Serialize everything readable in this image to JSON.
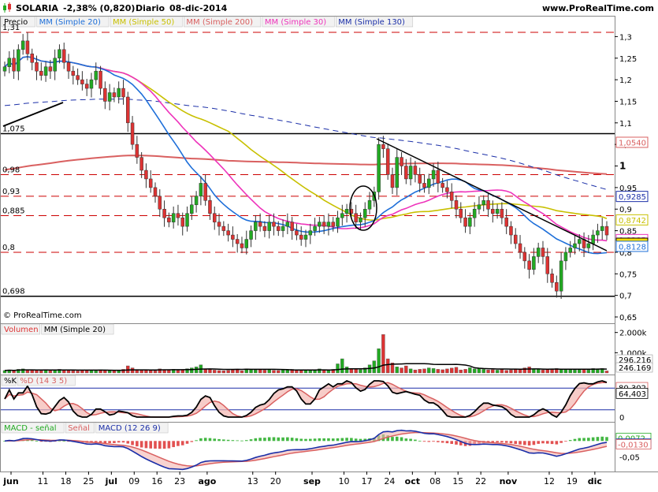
{
  "header": {
    "ticker": "SOLARIA",
    "change": "-2,38% (0,820)",
    "period": "Diario",
    "date": "08-dic-2014",
    "site": "www.ProRealTime.com",
    "copyright": "© ProRealTime.com"
  },
  "colors": {
    "price_up": "#22aa22",
    "price_down": "#dd3333",
    "sma20": "#1e6fd9",
    "sma50": "#c8c000",
    "sma200": "#d96060",
    "sma30": "#ee33bb",
    "sma130": "#1b2fa8",
    "grid_dash": "#cc0000",
    "macd_line": "#1b2fa8",
    "signal_line": "#d96060",
    "stoch_k": "#000000",
    "stoch_d": "#d96060"
  },
  "price_panel": {
    "legend": [
      "Precio",
      "MM (Simple 20)",
      "MM (Simple 50)",
      "MM (Simple 200)",
      "MM (Simple 30)",
      "MM (Simple 130)"
    ],
    "left_labels": [
      {
        "text": "1,31",
        "value": 1.31
      },
      {
        "text": "1,075",
        "value": 1.075
      },
      {
        "text": "0,98",
        "value": 0.98
      },
      {
        "text": "0,93",
        "value": 0.93
      },
      {
        "text": "0,885",
        "value": 0.885
      },
      {
        "text": "0,8",
        "value": 0.8
      },
      {
        "text": "0,698",
        "value": 0.698
      }
    ],
    "axis_ticks": [
      "1,3",
      "1,25",
      "1,2",
      "1,15",
      "1,1",
      "1,05",
      "1",
      "0,95",
      "0,9",
      "0,85",
      "0,8",
      "0,75",
      "0,7",
      "0,65"
    ],
    "right_tags": [
      {
        "text": "1,0540",
        "value": 1.054,
        "color": "#d96060"
      },
      {
        "text": "0,9285",
        "value": 0.9285,
        "color": "#1b2fa8"
      },
      {
        "text": "0,8742",
        "value": 0.8742,
        "color": "#c8c000"
      },
      {
        "text": "0,8285",
        "value": 0.8285,
        "color": "#ee33bb"
      },
      {
        "text": "0,820",
        "value": 0.82,
        "color": "#000000"
      },
      {
        "text": "0,8128",
        "value": 0.8128,
        "color": "#1e6fd9"
      }
    ]
  },
  "volume_panel": {
    "legend": [
      "Volumen",
      "MM (Simple 20)"
    ],
    "axis_ticks": [
      "2.000k",
      "1.000k"
    ],
    "right_tags": [
      {
        "text": "296.216",
        "value": 296216
      },
      {
        "text": "246.169",
        "value": 246169
      }
    ]
  },
  "stoch_panel": {
    "legend": [
      "%K",
      "%D (14 3 5)"
    ],
    "axis_ticks": [
      "0"
    ],
    "right_tags": [
      {
        "text": "80,302",
        "value": 80.302
      },
      {
        "text": "64,403",
        "value": 64.403
      }
    ]
  },
  "macd_panel": {
    "legend": [
      "MACD - señal",
      "Señal",
      "MACD (12 26 9)"
    ],
    "axis_ticks": [
      "-0,05"
    ],
    "right_tags": [
      {
        "text": "0,0072",
        "value": 0.0072
      },
      {
        "text": "-0,0057",
        "value": -0.0057
      },
      {
        "text": "-0,0130",
        "value": -0.013
      }
    ]
  },
  "x_axis": {
    "labels": [
      "jun",
      "11",
      "18",
      "25",
      "jul",
      "09",
      "16",
      "23",
      "ago",
      "13",
      "20",
      "sep",
      "10",
      "17",
      "24",
      "oct",
      "08",
      "15",
      "22",
      "nov",
      "12",
      "19",
      "dic"
    ],
    "idx": [
      0,
      7,
      12,
      17,
      22,
      27,
      32,
      37,
      43,
      53,
      58,
      66,
      73,
      78,
      83,
      88,
      93,
      98,
      103,
      109,
      118,
      123,
      128
    ]
  },
  "chart_data": {
    "type": "candlestick",
    "title": "SOLARIA -2,38% (0,820) Diario 08-dic-2014",
    "x_start": "jun 2014",
    "x_end": "08-dic-2014",
    "price_range": [
      0.65,
      1.33
    ],
    "close": [
      1.23,
      1.25,
      1.22,
      1.27,
      1.29,
      1.26,
      1.24,
      1.22,
      1.21,
      1.23,
      1.22,
      1.25,
      1.27,
      1.24,
      1.22,
      1.21,
      1.2,
      1.19,
      1.18,
      1.2,
      1.22,
      1.18,
      1.15,
      1.17,
      1.16,
      1.18,
      1.16,
      1.1,
      1.05,
      1.02,
      0.99,
      0.97,
      0.95,
      0.93,
      0.9,
      0.88,
      0.87,
      0.89,
      0.88,
      0.86,
      0.89,
      0.91,
      0.93,
      0.96,
      0.92,
      0.89,
      0.87,
      0.86,
      0.85,
      0.84,
      0.83,
      0.82,
      0.81,
      0.83,
      0.85,
      0.87,
      0.86,
      0.85,
      0.87,
      0.86,
      0.85,
      0.86,
      0.87,
      0.85,
      0.84,
      0.83,
      0.84,
      0.85,
      0.86,
      0.87,
      0.86,
      0.87,
      0.86,
      0.88,
      0.89,
      0.9,
      0.89,
      0.87,
      0.88,
      0.9,
      0.92,
      0.94,
      1.05,
      1.04,
      0.98,
      0.95,
      1.02,
      1.0,
      0.97,
      1.0,
      0.98,
      0.96,
      0.95,
      0.97,
      0.99,
      0.96,
      0.95,
      0.94,
      0.92,
      0.9,
      0.88,
      0.86,
      0.88,
      0.9,
      0.91,
      0.92,
      0.9,
      0.89,
      0.9,
      0.88,
      0.86,
      0.84,
      0.82,
      0.8,
      0.78,
      0.76,
      0.79,
      0.81,
      0.79,
      0.75,
      0.73,
      0.71,
      0.78,
      0.8,
      0.81,
      0.82,
      0.83,
      0.81,
      0.82,
      0.84,
      0.85,
      0.86,
      0.84
    ],
    "volume_k": [
      120,
      150,
      110,
      180,
      200,
      160,
      140,
      130,
      110,
      170,
      120,
      140,
      180,
      150,
      120,
      110,
      100,
      130,
      120,
      140,
      110,
      160,
      130,
      120,
      140,
      120,
      180,
      350,
      250,
      170,
      130,
      150,
      120,
      110,
      200,
      160,
      140,
      180,
      130,
      150,
      210,
      250,
      300,
      400,
      200,
      170,
      140,
      120,
      110,
      130,
      150,
      180,
      110,
      200,
      170,
      150,
      160,
      140,
      170,
      130,
      120,
      150,
      140,
      180,
      130,
      120,
      150,
      160,
      140,
      200,
      150,
      130,
      180,
      450,
      700,
      300,
      200,
      180,
      160,
      250,
      400,
      600,
      1200,
      1900,
      700,
      500,
      300,
      250,
      350,
      200,
      150,
      180,
      200,
      250,
      220,
      180,
      160,
      200,
      240,
      280,
      150,
      180,
      260,
      200,
      240,
      180,
      150,
      160,
      140,
      170,
      130,
      150,
      180,
      200,
      250,
      300,
      200,
      180,
      150,
      200,
      170,
      220,
      180,
      200,
      160,
      150,
      200,
      170,
      150,
      220,
      180,
      220,
      100
    ],
    "stoch_k_range": [
      0,
      100
    ],
    "sma_last": {
      "sma20": 0.8128,
      "sma30": 0.8285,
      "sma50": 0.8742,
      "sma130": 0.9285,
      "sma200": 1.054
    }
  }
}
